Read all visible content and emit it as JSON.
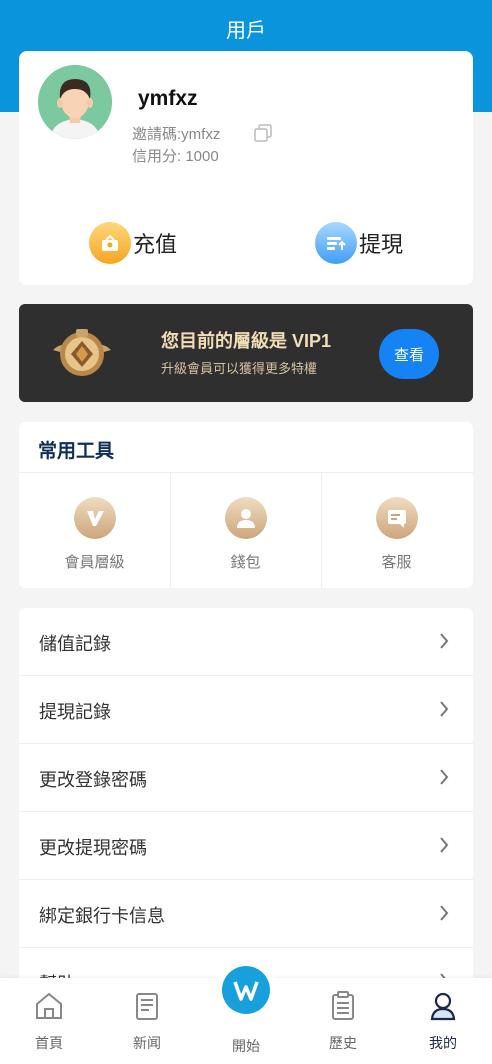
{
  "header": {
    "title": "用戶"
  },
  "profile": {
    "username": "ymfxz",
    "invite_code": "邀請碼:ymfxz",
    "credit": "信用分: 1000",
    "icons": {
      "avatar": "user-avatar",
      "copy": "copy-icon"
    }
  },
  "actions": [
    {
      "label": "充值",
      "icon": "recharge-icon"
    },
    {
      "label": "提現",
      "icon": "withdraw-icon"
    }
  ],
  "vip": {
    "title": "您目前的層級是 VIP1",
    "subtitle": "升級會員可以獲得更多特權",
    "button": "查看"
  },
  "tools": {
    "heading": "常用工具",
    "items": [
      {
        "label": "會員層級",
        "icon": "vip-level-icon"
      },
      {
        "label": "錢包",
        "icon": "wallet-icon"
      },
      {
        "label": "客服",
        "icon": "customer-service-icon"
      }
    ]
  },
  "menu": [
    {
      "label": "儲值記錄"
    },
    {
      "label": "提現記錄"
    },
    {
      "label": "更改登錄密碼"
    },
    {
      "label": "更改提現密碼"
    },
    {
      "label": "綁定銀行卡信息"
    },
    {
      "label": "幫助"
    }
  ],
  "tabbar": [
    {
      "label": "首頁",
      "icon": "home-icon"
    },
    {
      "label": "新闻",
      "icon": "news-icon"
    },
    {
      "label": "開始",
      "icon": "start-icon"
    },
    {
      "label": "歷史",
      "icon": "history-icon"
    },
    {
      "label": "我的",
      "icon": "profile-icon",
      "active": true
    }
  ],
  "colors": {
    "primary": "#0a94db",
    "vip_bg": "#2f2f2f",
    "vip_button": "#1683f4",
    "gold": "#cda57c"
  }
}
